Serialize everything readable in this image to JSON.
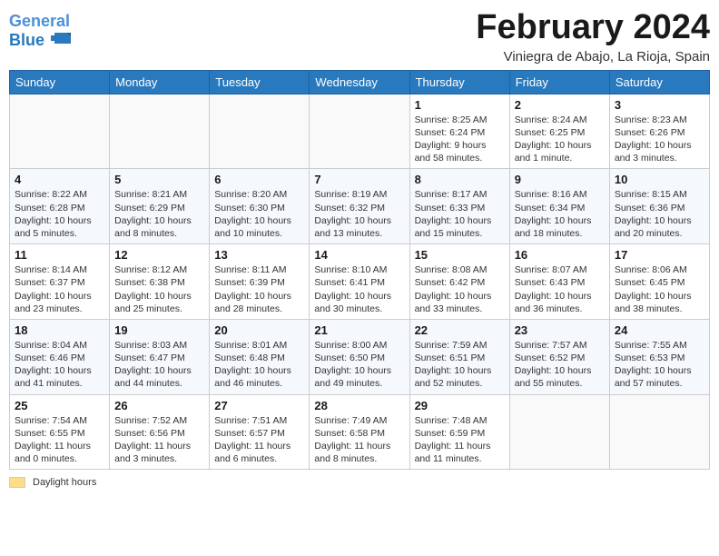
{
  "header": {
    "logo_line1": "General",
    "logo_line2": "Blue",
    "month_title": "February 2024",
    "subtitle": "Viniegra de Abajo, La Rioja, Spain"
  },
  "days_of_week": [
    "Sunday",
    "Monday",
    "Tuesday",
    "Wednesday",
    "Thursday",
    "Friday",
    "Saturday"
  ],
  "footer": {
    "daylight_label": "Daylight hours"
  },
  "weeks": [
    [
      {
        "day": "",
        "info": ""
      },
      {
        "day": "",
        "info": ""
      },
      {
        "day": "",
        "info": ""
      },
      {
        "day": "",
        "info": ""
      },
      {
        "day": "1",
        "info": "Sunrise: 8:25 AM\nSunset: 6:24 PM\nDaylight: 9 hours and 58 minutes."
      },
      {
        "day": "2",
        "info": "Sunrise: 8:24 AM\nSunset: 6:25 PM\nDaylight: 10 hours and 1 minute."
      },
      {
        "day": "3",
        "info": "Sunrise: 8:23 AM\nSunset: 6:26 PM\nDaylight: 10 hours and 3 minutes."
      }
    ],
    [
      {
        "day": "4",
        "info": "Sunrise: 8:22 AM\nSunset: 6:28 PM\nDaylight: 10 hours and 5 minutes."
      },
      {
        "day": "5",
        "info": "Sunrise: 8:21 AM\nSunset: 6:29 PM\nDaylight: 10 hours and 8 minutes."
      },
      {
        "day": "6",
        "info": "Sunrise: 8:20 AM\nSunset: 6:30 PM\nDaylight: 10 hours and 10 minutes."
      },
      {
        "day": "7",
        "info": "Sunrise: 8:19 AM\nSunset: 6:32 PM\nDaylight: 10 hours and 13 minutes."
      },
      {
        "day": "8",
        "info": "Sunrise: 8:17 AM\nSunset: 6:33 PM\nDaylight: 10 hours and 15 minutes."
      },
      {
        "day": "9",
        "info": "Sunrise: 8:16 AM\nSunset: 6:34 PM\nDaylight: 10 hours and 18 minutes."
      },
      {
        "day": "10",
        "info": "Sunrise: 8:15 AM\nSunset: 6:36 PM\nDaylight: 10 hours and 20 minutes."
      }
    ],
    [
      {
        "day": "11",
        "info": "Sunrise: 8:14 AM\nSunset: 6:37 PM\nDaylight: 10 hours and 23 minutes."
      },
      {
        "day": "12",
        "info": "Sunrise: 8:12 AM\nSunset: 6:38 PM\nDaylight: 10 hours and 25 minutes."
      },
      {
        "day": "13",
        "info": "Sunrise: 8:11 AM\nSunset: 6:39 PM\nDaylight: 10 hours and 28 minutes."
      },
      {
        "day": "14",
        "info": "Sunrise: 8:10 AM\nSunset: 6:41 PM\nDaylight: 10 hours and 30 minutes."
      },
      {
        "day": "15",
        "info": "Sunrise: 8:08 AM\nSunset: 6:42 PM\nDaylight: 10 hours and 33 minutes."
      },
      {
        "day": "16",
        "info": "Sunrise: 8:07 AM\nSunset: 6:43 PM\nDaylight: 10 hours and 36 minutes."
      },
      {
        "day": "17",
        "info": "Sunrise: 8:06 AM\nSunset: 6:45 PM\nDaylight: 10 hours and 38 minutes."
      }
    ],
    [
      {
        "day": "18",
        "info": "Sunrise: 8:04 AM\nSunset: 6:46 PM\nDaylight: 10 hours and 41 minutes."
      },
      {
        "day": "19",
        "info": "Sunrise: 8:03 AM\nSunset: 6:47 PM\nDaylight: 10 hours and 44 minutes."
      },
      {
        "day": "20",
        "info": "Sunrise: 8:01 AM\nSunset: 6:48 PM\nDaylight: 10 hours and 46 minutes."
      },
      {
        "day": "21",
        "info": "Sunrise: 8:00 AM\nSunset: 6:50 PM\nDaylight: 10 hours and 49 minutes."
      },
      {
        "day": "22",
        "info": "Sunrise: 7:59 AM\nSunset: 6:51 PM\nDaylight: 10 hours and 52 minutes."
      },
      {
        "day": "23",
        "info": "Sunrise: 7:57 AM\nSunset: 6:52 PM\nDaylight: 10 hours and 55 minutes."
      },
      {
        "day": "24",
        "info": "Sunrise: 7:55 AM\nSunset: 6:53 PM\nDaylight: 10 hours and 57 minutes."
      }
    ],
    [
      {
        "day": "25",
        "info": "Sunrise: 7:54 AM\nSunset: 6:55 PM\nDaylight: 11 hours and 0 minutes."
      },
      {
        "day": "26",
        "info": "Sunrise: 7:52 AM\nSunset: 6:56 PM\nDaylight: 11 hours and 3 minutes."
      },
      {
        "day": "27",
        "info": "Sunrise: 7:51 AM\nSunset: 6:57 PM\nDaylight: 11 hours and 6 minutes."
      },
      {
        "day": "28",
        "info": "Sunrise: 7:49 AM\nSunset: 6:58 PM\nDaylight: 11 hours and 8 minutes."
      },
      {
        "day": "29",
        "info": "Sunrise: 7:48 AM\nSunset: 6:59 PM\nDaylight: 11 hours and 11 minutes."
      },
      {
        "day": "",
        "info": ""
      },
      {
        "day": "",
        "info": ""
      }
    ]
  ]
}
